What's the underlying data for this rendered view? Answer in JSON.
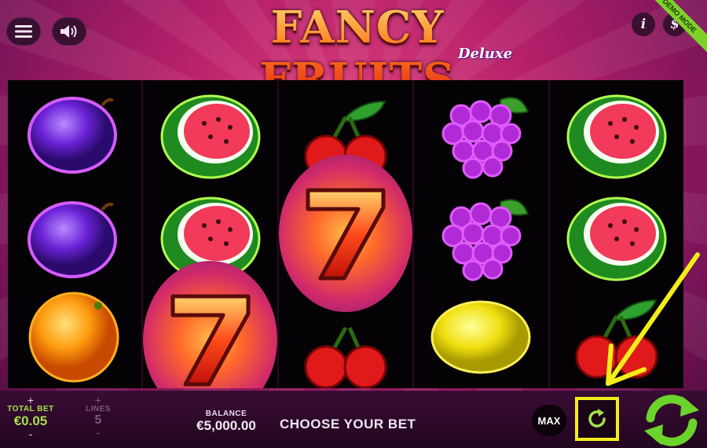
{
  "game": {
    "title": "FANCY FRUITS",
    "subtitle": "Deluxe",
    "demo_badge": "DEMO MODE"
  },
  "top_buttons": {
    "menu_icon": "hamburger-menu-icon",
    "sound_icon": "speaker-icon",
    "info_label": "i",
    "paytable_label": "$"
  },
  "reels": [
    [
      "plum",
      "plum",
      "orange"
    ],
    [
      "watermelon",
      "watermelon",
      "seven"
    ],
    [
      "cherry",
      "seven",
      "cherry"
    ],
    [
      "grapes",
      "grapes",
      "lemon"
    ],
    [
      "watermelon",
      "watermelon",
      "cherry"
    ]
  ],
  "bottom_bar": {
    "total_bet": {
      "label": "TOTAL BET",
      "value": "€0.05",
      "plus": "+",
      "minus": "-"
    },
    "lines": {
      "label": "LINES",
      "value": "5",
      "plus": "+",
      "minus": "-"
    },
    "balance": {
      "label": "BALANCE",
      "value": "€5,000.00"
    },
    "message": "CHOOSE YOUR BET",
    "max_label": "MAX",
    "autoplay_icon": "refresh-icon",
    "spin_icon": "spin-arrows-icon"
  },
  "colors": {
    "highlight": "#f3ee18",
    "spin_green": "#6bd42a",
    "demo_green": "#7fd12a"
  }
}
